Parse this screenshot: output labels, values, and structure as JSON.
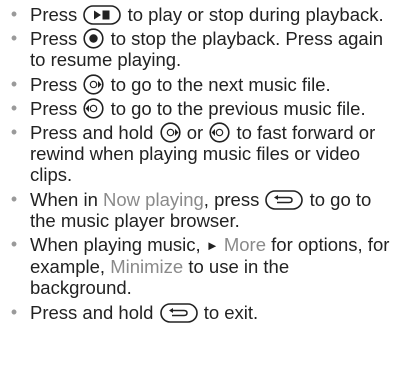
{
  "bullet_glyph": "•",
  "items": [
    {
      "before": "Press",
      "icon": "play-stop-key-icon",
      "after": "to play or stop during playback."
    },
    {
      "before": "Press",
      "icon": "center-key-icon",
      "after": "to stop the playback. Press again to resume playing."
    },
    {
      "before": "Press",
      "icon": "navigation-right-key-icon",
      "after": "to go to the next music file."
    },
    {
      "before": "Press",
      "icon": "navigation-left-key-icon",
      "after": "to go to the previous music file."
    },
    {
      "before": "Press and hold",
      "icon_a": "navigation-right-key-icon",
      "mid": "or",
      "icon_b": "navigation-left-key-icon",
      "after": "to fast forward or rewind when playing music files or video clips."
    },
    {
      "before": "When in",
      "highlight": "Now playing",
      "middle": ", press",
      "icon": "back-key-icon",
      "after": "to go to the music player browser."
    },
    {
      "before": "When playing music,",
      "arrow": "►",
      "link": "More",
      "middle": "for options, for example,",
      "highlight": "Minimize",
      "after": "to use in the background."
    },
    {
      "before": "Press and hold",
      "icon": "back-key-icon",
      "after": "to exit."
    }
  ],
  "colors": {
    "text": "#222222",
    "highlight": "#8a8a8a",
    "bullet": "#9a9a9a"
  }
}
